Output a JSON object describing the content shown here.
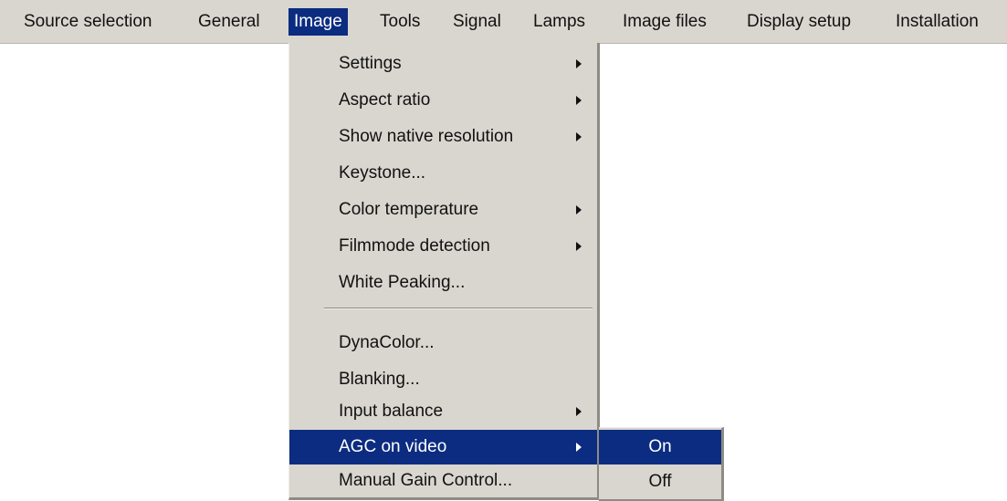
{
  "colors": {
    "menu_background": "#d9d6cf",
    "highlight": "#0b2c80",
    "highlight_text": "#ffffff",
    "text": "#111111"
  },
  "menubar": {
    "items": [
      {
        "label": "Source selection"
      },
      {
        "label": "General"
      },
      {
        "label": "Image",
        "active": true
      },
      {
        "label": "Tools"
      },
      {
        "label": "Signal"
      },
      {
        "label": "Lamps"
      },
      {
        "label": "Image files"
      },
      {
        "label": "Display setup"
      },
      {
        "label": "Installation"
      }
    ]
  },
  "image_menu": {
    "items": [
      {
        "label": "Settings",
        "submenu": true
      },
      {
        "label": "Aspect ratio",
        "submenu": true
      },
      {
        "label": "Show native resolution",
        "submenu": true
      },
      {
        "label": "Keystone...",
        "submenu": false
      },
      {
        "label": "Color temperature",
        "submenu": true
      },
      {
        "label": "Filmmode detection",
        "submenu": true
      },
      {
        "label": "White Peaking...",
        "submenu": false
      },
      {
        "label": "DynaColor...",
        "submenu": false
      },
      {
        "label": "Blanking...",
        "submenu": false
      },
      {
        "label": "Input balance",
        "submenu": true
      },
      {
        "label": "AGC on video",
        "submenu": true,
        "active": true
      },
      {
        "label": "Manual Gain Control...",
        "submenu": false
      }
    ]
  },
  "agc_submenu": {
    "items": [
      {
        "label": "On",
        "active": true
      },
      {
        "label": "Off"
      }
    ]
  },
  "icons": {
    "submenu_indicator": "triangle-right-icon"
  }
}
